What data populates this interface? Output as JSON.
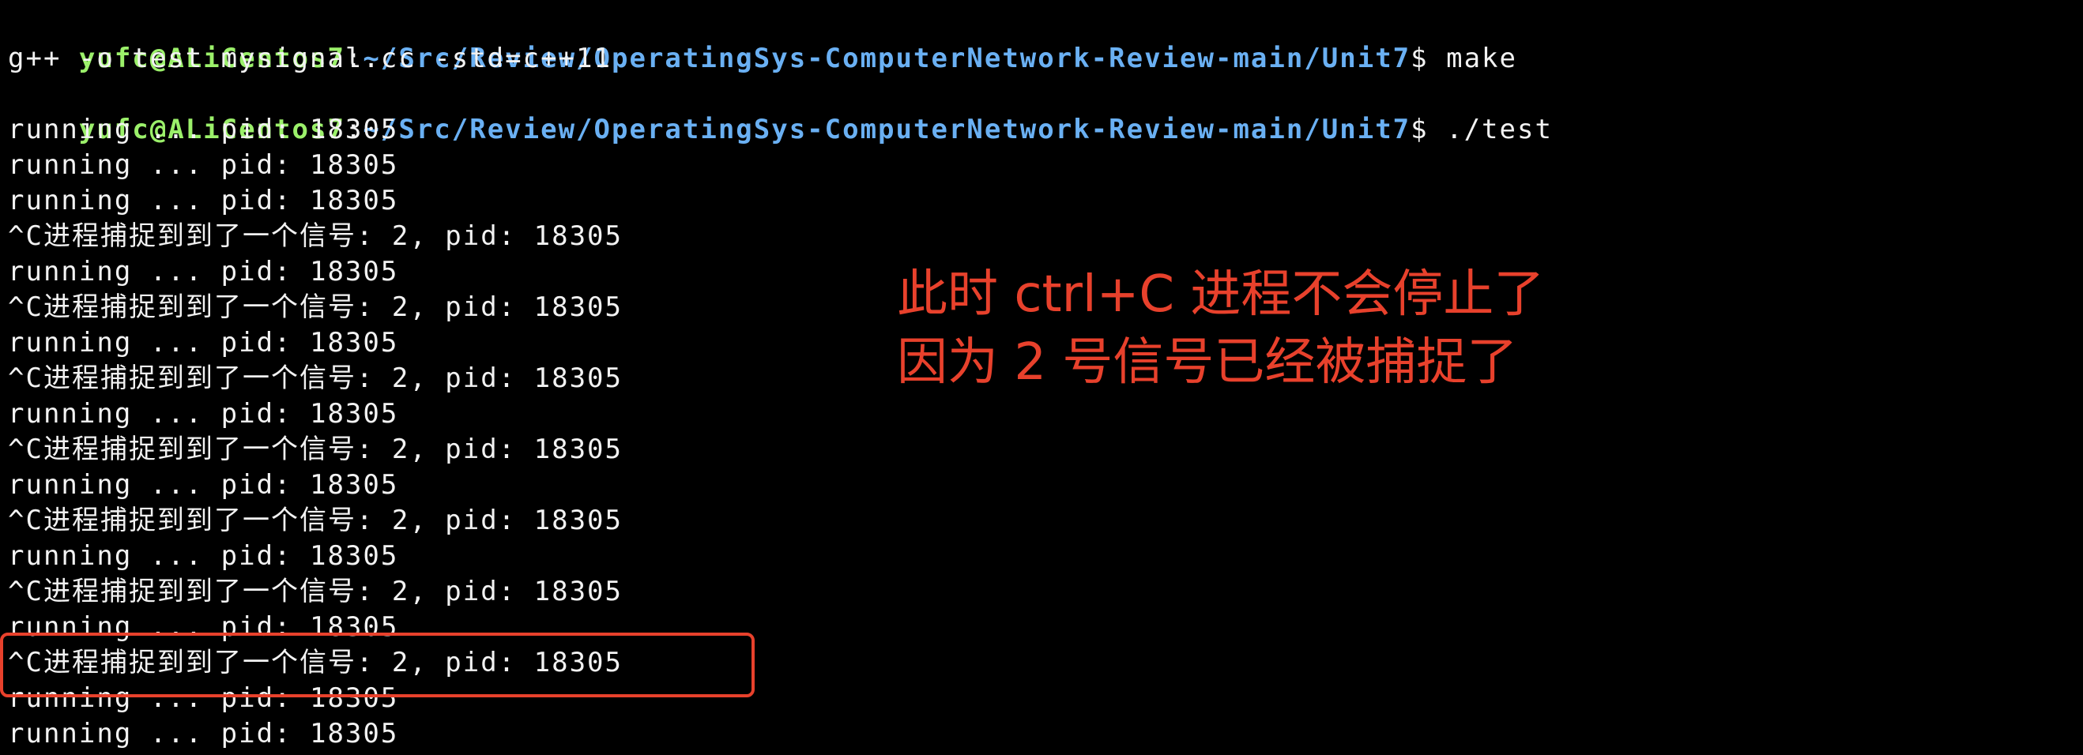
{
  "terminal": {
    "prompts": [
      {
        "user_host": "yufc@ALiCentos7",
        "sep": ":",
        "path": "~/Src/Review/OperatingSys-ComputerNetwork-Review-main/Unit7",
        "symbol": "$ ",
        "command": "make"
      },
      {
        "user_host": "yufc@ALiCentos7",
        "sep": ":",
        "path": "~/Src/Review/OperatingSys-ComputerNetwork-Review-main/Unit7",
        "symbol": "$ ",
        "command": "./test"
      }
    ],
    "compile_line": "g++ -o test mysignal.cc -std=c++11",
    "running_line": "running ... pid: 18305",
    "signal_line": "^C进程捕捉到到了一个信号: 2, pid: 18305"
  },
  "annotation": {
    "line1": "此时 ctrl+C 进程不会停止了",
    "line2": "因为 2 号信号已经被捕捉了",
    "color": "#e8412c"
  },
  "colors": {
    "background": "#000000",
    "text": "#f2f2f2",
    "user": "#9bf06a",
    "path": "#6ab0f3"
  }
}
